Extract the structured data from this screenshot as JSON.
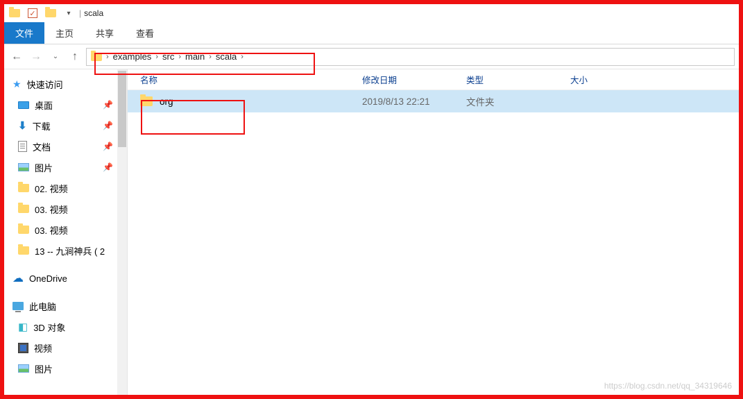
{
  "title": "scala",
  "ribbon": {
    "file": "文件",
    "home": "主页",
    "share": "共享",
    "view": "查看"
  },
  "breadcrumb": [
    "examples",
    "src",
    "main",
    "scala"
  ],
  "columns": {
    "name": "名称",
    "date": "修改日期",
    "type": "类型",
    "size": "大小"
  },
  "rows": [
    {
      "name": "org",
      "date": "2019/8/13 22:21",
      "type": "文件夹",
      "size": ""
    }
  ],
  "sidebar": {
    "quick": {
      "label": "快速访问",
      "items": [
        {
          "label": "桌面",
          "icon": "desktop",
          "pin": true
        },
        {
          "label": "下载",
          "icon": "down",
          "pin": true
        },
        {
          "label": "文档",
          "icon": "doc",
          "pin": true
        },
        {
          "label": "图片",
          "icon": "pic",
          "pin": true
        },
        {
          "label": "02. 视频",
          "icon": "folder"
        },
        {
          "label": "03. 视频",
          "icon": "folder"
        },
        {
          "label": "03. 视频",
          "icon": "folder"
        },
        {
          "label": "13 -- 九涧神兵 ( 2",
          "icon": "folder"
        }
      ]
    },
    "onedrive": "OneDrive",
    "thispc": {
      "label": "此电脑",
      "items": [
        "3D 对象",
        "视频",
        "图片"
      ]
    }
  },
  "watermark": "https://blog.csdn.net/qq_34319646"
}
